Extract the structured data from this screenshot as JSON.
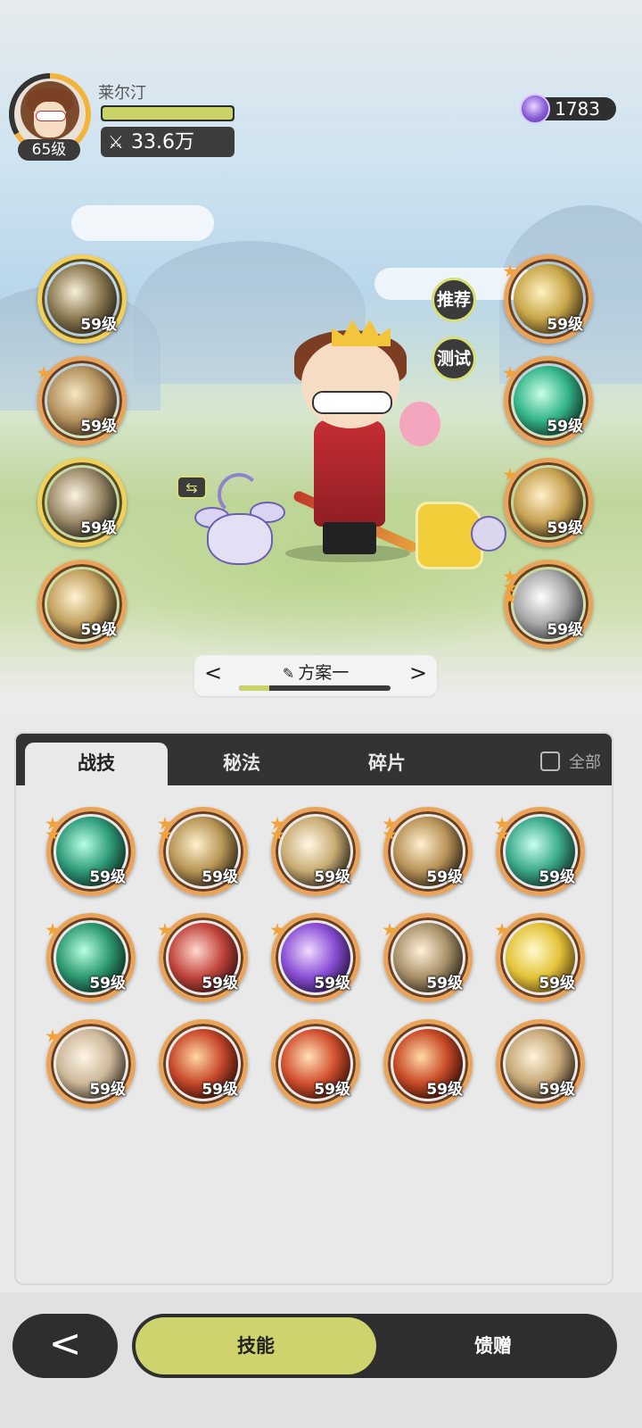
{
  "player": {
    "name": "莱尔汀",
    "level": "65级",
    "hp_fraction": 1.0,
    "power": "33.6万",
    "currency": "1783"
  },
  "side_buttons": {
    "recommend": "推荐",
    "test": "测试"
  },
  "left_skills": [
    {
      "level": "59级",
      "stars": 0,
      "frame": "gold",
      "art": [
        "#f7f0d8",
        "#8c7a52",
        "#2a2418"
      ]
    },
    {
      "level": "59级",
      "stars": 1,
      "frame": "orange",
      "art": [
        "#f6e7c4",
        "#b3915e",
        "#3a2a18"
      ]
    },
    {
      "level": "59级",
      "stars": 0,
      "frame": "gold",
      "art": [
        "#fbf4e3",
        "#9b8a68",
        "#262218"
      ]
    },
    {
      "level": "59级",
      "stars": 0,
      "frame": "orange",
      "art": [
        "#fff3d2",
        "#c2a160",
        "#2a2012"
      ]
    }
  ],
  "right_skills": [
    {
      "level": "59级",
      "stars": 1,
      "frame": "orange",
      "art": [
        "#fff2c0",
        "#c9a64a",
        "#3b2d14"
      ]
    },
    {
      "level": "59级",
      "stars": 1,
      "frame": "orange",
      "art": [
        "#c9ffe8",
        "#34b58a",
        "#0f3327"
      ]
    },
    {
      "level": "59级",
      "stars": 1,
      "frame": "orange",
      "art": [
        "#fff0c8",
        "#c8a253",
        "#2e2414"
      ]
    },
    {
      "level": "59级",
      "stars": 3,
      "frame": "orange",
      "art": [
        "#ffffff",
        "#a8a8a8",
        "#3a3a3a"
      ]
    }
  ],
  "plan": {
    "title": "方案一",
    "progress": 0.2
  },
  "panel": {
    "tabs": [
      "战技",
      "秘法",
      "碎片"
    ],
    "active_tab": 0,
    "all_label": "全部",
    "skills": [
      {
        "level": "59级",
        "stars": 2,
        "art": [
          "#b8ffe6",
          "#2f9c7a",
          "#0d2a22"
        ]
      },
      {
        "level": "59级",
        "stars": 2,
        "art": [
          "#fff1cf",
          "#b79556",
          "#2b2114"
        ]
      },
      {
        "level": "59级",
        "stars": 2,
        "art": [
          "#fff8e6",
          "#c9ac74",
          "#2c2418"
        ]
      },
      {
        "level": "59级",
        "stars": 2,
        "art": [
          "#fff0d0",
          "#b89358",
          "#2a1f12"
        ]
      },
      {
        "level": "59级",
        "stars": 2,
        "art": [
          "#c8fff0",
          "#3ba98a",
          "#0f2e26"
        ]
      },
      {
        "level": "59级",
        "stars": 1,
        "art": [
          "#b9ffe0",
          "#2e9a72",
          "#0c2a20"
        ]
      },
      {
        "level": "59级",
        "stars": 1,
        "art": [
          "#ffd8d0",
          "#c2463d",
          "#3a0f0f"
        ]
      },
      {
        "level": "59级",
        "stars": 1,
        "art": [
          "#f0dcff",
          "#8b4fd6",
          "#24103f"
        ]
      },
      {
        "level": "59级",
        "stars": 1,
        "art": [
          "#fff2da",
          "#a9926a",
          "#2a2418"
        ]
      },
      {
        "level": "59级",
        "stars": 1,
        "art": [
          "#fffbd0",
          "#e5c43a",
          "#5a4410"
        ]
      },
      {
        "level": "59级",
        "stars": 1,
        "art": [
          "#fff6e8",
          "#cdb89a",
          "#3a3024"
        ]
      },
      {
        "level": "59级",
        "stars": 0,
        "art": [
          "#ffd7a0",
          "#c7472a",
          "#2c0e08"
        ]
      },
      {
        "level": "59级",
        "stars": 0,
        "art": [
          "#ffe0b8",
          "#d3502f",
          "#3a1208"
        ]
      },
      {
        "level": "59级",
        "stars": 0,
        "art": [
          "#ffd9a8",
          "#c84a26",
          "#2e0d06"
        ]
      },
      {
        "level": "59级",
        "stars": 0,
        "art": [
          "#fff4dc",
          "#c6a878",
          "#2c2216"
        ]
      }
    ]
  },
  "nav": {
    "back_icon": "back-arrow-icon",
    "tabs": [
      "技能",
      "馈赠"
    ],
    "active": 0
  },
  "colors": {
    "accent": "#cfd36d",
    "frame_orange": "#e9a45a",
    "frame_gold": "#f0cf5a",
    "dark": "#2e2e2e"
  }
}
